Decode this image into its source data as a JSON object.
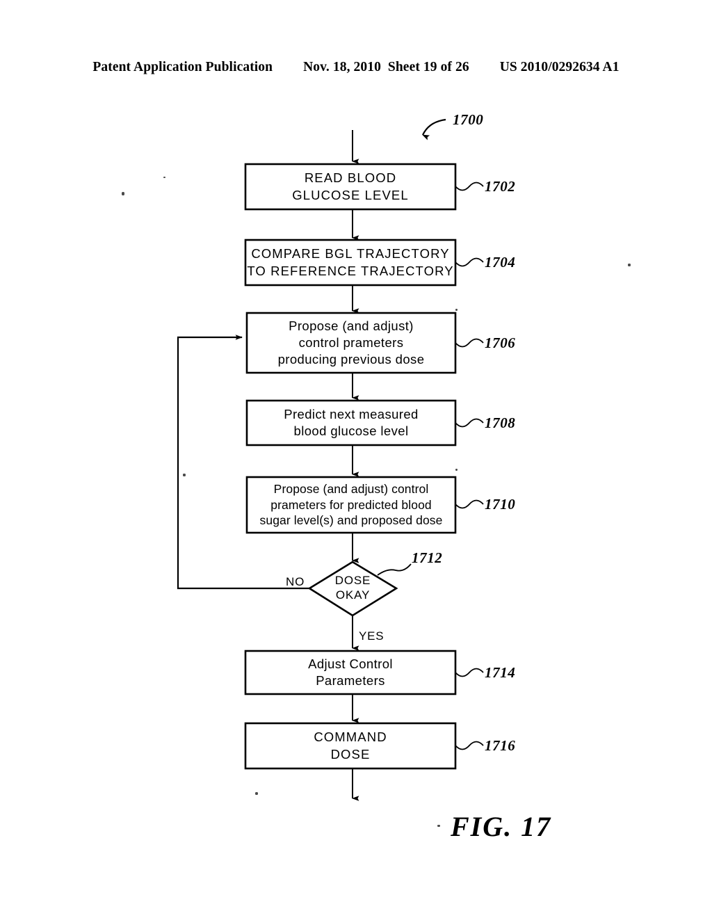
{
  "header": {
    "publication": "Patent Application Publication",
    "date": "Nov. 18, 2010",
    "sheet": "Sheet 19 of 26",
    "patent_number": "US 2010/0292634 A1"
  },
  "figure": {
    "caption": "FIG. 17",
    "reference": "1700"
  },
  "flowchart": {
    "nodes": [
      {
        "id": "1702",
        "ref": "1702",
        "shape": "process",
        "style": "caps",
        "lines": [
          "READ  BLOOD",
          "GLUCOSE  LEVEL"
        ]
      },
      {
        "id": "1704",
        "ref": "1704",
        "shape": "process",
        "style": "caps",
        "lines": [
          "COMPARE  BGL  TRAJECTORY",
          "TO  REFERENCE  TRAJECTORY"
        ]
      },
      {
        "id": "1706",
        "ref": "1706",
        "shape": "process",
        "style": "mixed",
        "lines": [
          "Propose  (and  adjust)",
          "control  prameters",
          "producing  previous  dose"
        ]
      },
      {
        "id": "1708",
        "ref": "1708",
        "shape": "process",
        "style": "mixed",
        "lines": [
          "Predict  next  measured",
          "blood  glucose  level"
        ]
      },
      {
        "id": "1710",
        "ref": "1710",
        "shape": "process",
        "style": "mixed-tight",
        "lines": [
          "Propose  (and  adjust)  control",
          "prameters  for  predicted  blood",
          "sugar  level(s)  and  proposed  dose"
        ]
      },
      {
        "id": "1712",
        "ref": "1712",
        "shape": "decision",
        "style": "caps",
        "lines": [
          "DOSE",
          "OKAY"
        ]
      },
      {
        "id": "1714",
        "ref": "1714",
        "shape": "process",
        "style": "mixed",
        "lines": [
          "Adjust  Control",
          "Parameters"
        ]
      },
      {
        "id": "1716",
        "ref": "1716",
        "shape": "process",
        "style": "caps",
        "lines": [
          "COMMAND",
          "DOSE"
        ]
      }
    ],
    "branch_labels": {
      "no": "NO",
      "yes": "YES"
    }
  },
  "colors": {
    "ink": "#000000",
    "paper": "#ffffff"
  }
}
